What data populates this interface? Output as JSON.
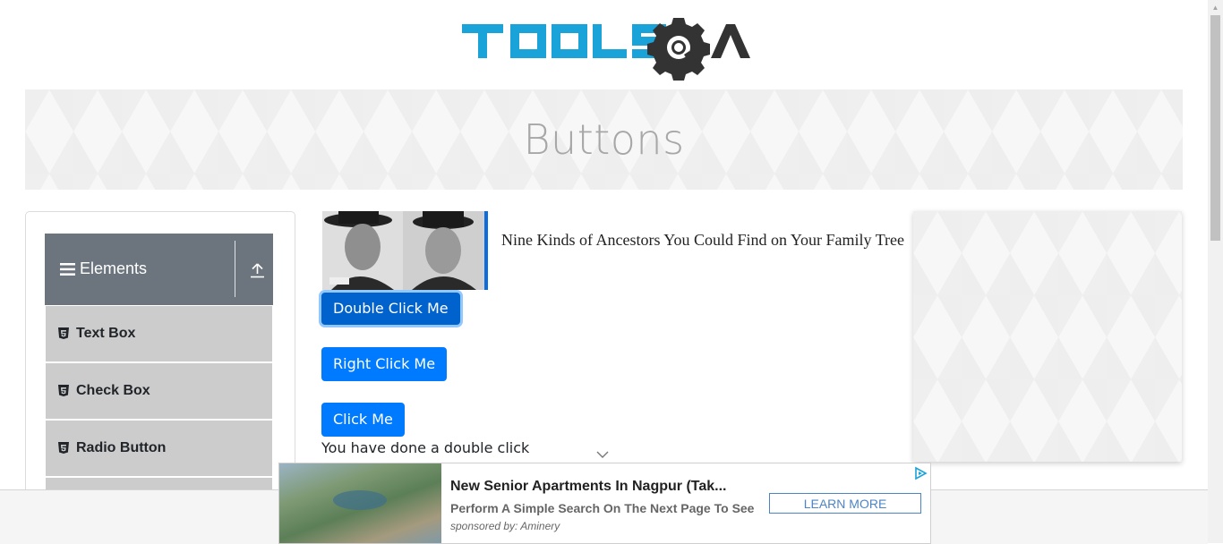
{
  "header": {
    "logo_text": "TOOLSQA",
    "page_title": "Buttons"
  },
  "sidebar": {
    "group_title": "Elements",
    "items": [
      {
        "label": "Text Box"
      },
      {
        "label": "Check Box"
      },
      {
        "label": "Radio Button"
      }
    ]
  },
  "ad": {
    "headline": "Nine Kinds of Ancestors You Could Find on Your Family Tree"
  },
  "buttons": {
    "double_click": "Double Click Me",
    "right_click": "Right Click Me",
    "click": "Click Me"
  },
  "message": "You have done a double click",
  "bottom_ad": {
    "headline": "New Senior Apartments In Nagpur (Tak...",
    "description": "Perform A Simple Search On The Next Page To See...",
    "sponsor": "sponsored by: Aminery",
    "cta": "LEARN MORE"
  },
  "colors": {
    "primary": "#007bff",
    "logo_blue": "#1aa3d8",
    "logo_dark": "#333333",
    "header_grey": "#6c757d"
  }
}
